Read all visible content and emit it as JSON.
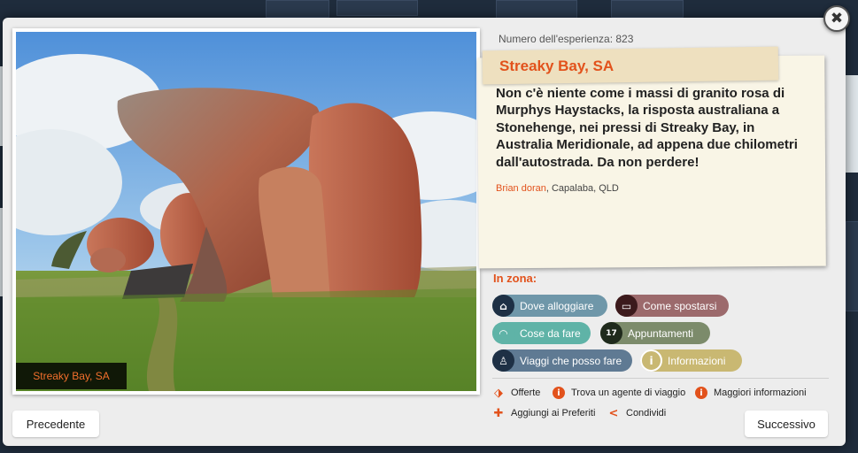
{
  "experience": {
    "number_text": "Numero dell'esperienza: 823",
    "title": "Streaky Bay, SA",
    "description": "Non c'è niente come i massi di granito rosa di Murphys Haystacks, la risposta australiana a Stonehenge, nei pressi di Streaky Bay, in Australia Meridionale, ad appena due chilometri dall'autostrada. Da non perdere!",
    "author_name": "Brian doran",
    "author_location": ", Capalaba, QLD",
    "photo_caption": "Streaky Bay, SA"
  },
  "nearby": {
    "heading": "In zona:",
    "items": [
      {
        "label": "Dove alloggiare",
        "icon": "house-icon",
        "color": "#6f97a9"
      },
      {
        "label": "Come spostarsi",
        "icon": "bus-icon",
        "color": "#9c6a6c"
      },
      {
        "label": "Cose da fare",
        "icon": "umbrella-icon",
        "color": "#5fb3a7"
      },
      {
        "label": "Appuntamenti",
        "icon": "calendar-icon",
        "color": "#7c8b6b"
      },
      {
        "label": "Viaggi che posso fare",
        "icon": "hiker-icon",
        "color": "#5f7a93"
      },
      {
        "label": "Informazioni",
        "icon": "info-icon",
        "color": "#c9b872"
      }
    ],
    "calendar_day": "17"
  },
  "links": {
    "offers": "Offerte",
    "find_agent": "Trova un agente di viaggio",
    "more_info": "Maggiori informazioni",
    "add_favorites": "Aggiungi ai Preferiti",
    "share": "Condividi"
  },
  "nav": {
    "previous": "Precedente",
    "next": "Successivo"
  },
  "close_symbol": "✖",
  "colors": {
    "accent": "#e2521c",
    "dark_icon": "#1e3045"
  }
}
